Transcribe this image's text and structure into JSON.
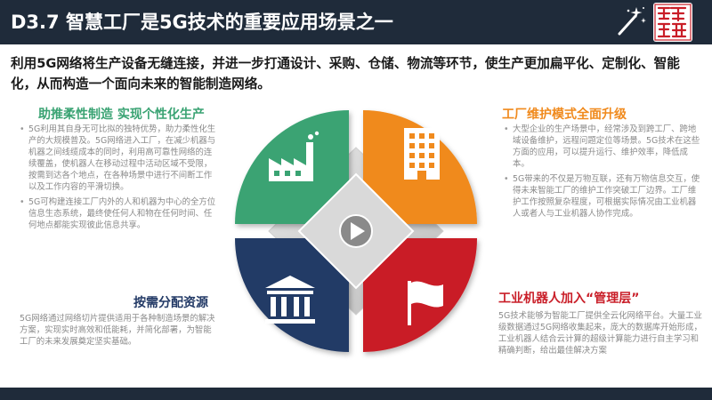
{
  "header": {
    "title": "D3.7 智慧工厂是5G技术的重要应用场景之一"
  },
  "intro": "利用5G网络将生产设备无缝连接，并进一步打通设计、采购、仓储、物流等环节，使生产更加扁平化、定制化、智能化，从而构造一个面向未来的智能制造网络。",
  "sections": {
    "top_left": {
      "title": "助推柔性制造 实现个性化生产",
      "bullets": [
        "5G利用其自身无可比拟的独特优势，助力柔性化生产的大规模普及。5G网络进入工厂，在减少机器与机器之间线缆成本的同时，利用高可靠性网络的连续覆盖，使机器人在移动过程中活动区域不受限，按需到达各个地点，在各种场景中进行不间断工作以及工作内容的平滑切换。",
        "5G可构建连接工厂内外的人和机器为中心的全方位信息生态系统，最终使任何人和物在任何时间、任何地点都能实现彼此信息共享。"
      ]
    },
    "top_right": {
      "title": "工厂维护模式全面升级",
      "bullets": [
        "大型企业的生产场景中，经常涉及到跨工厂、跨地域设备维护，远程问题定位等场景。5G技术在这些方面的应用，可以提升运行、维护效率，降低成本。",
        "5G带来的不仅是万物互联，还有万物信息交互，使得未来智能工厂的维护工作突破工厂边界。工厂维护工作按照复杂程度，可根据实际情况由工业机器人或者人与工业机器人协作完成。"
      ]
    },
    "bottom_left": {
      "title": "按需分配资源",
      "text": "5G网络通过网络切片提供适用于各种制造场景的解决方案，实现实时高效和低能耗，并简化部署，为智能工厂的未来发展奠定坚实基础。"
    },
    "bottom_right": {
      "title": "工业机器人加入“管理层”",
      "text": "5G技术能够为智能工厂提供全云化网络平台。大量工业级数据通过5G网络收集起来，庞大的数据库开始形成，工业机器人结合云计算的超级计算能力进行自主学习和精确判断，给出最佳解决方案"
    }
  },
  "colors": {
    "header_bg": "#1f2b3a",
    "green": "#3aa373",
    "orange": "#f08a1d",
    "blue": "#233a66",
    "red": "#c91e28",
    "body_text": "#8a8a8a"
  },
  "icons": {
    "top_left": "factory-icon",
    "top_right": "office-building-icon",
    "bottom_left": "institution-columns-icon",
    "bottom_right": "flag-icon",
    "center": "play-icon",
    "header": "magic-wand-icon"
  }
}
